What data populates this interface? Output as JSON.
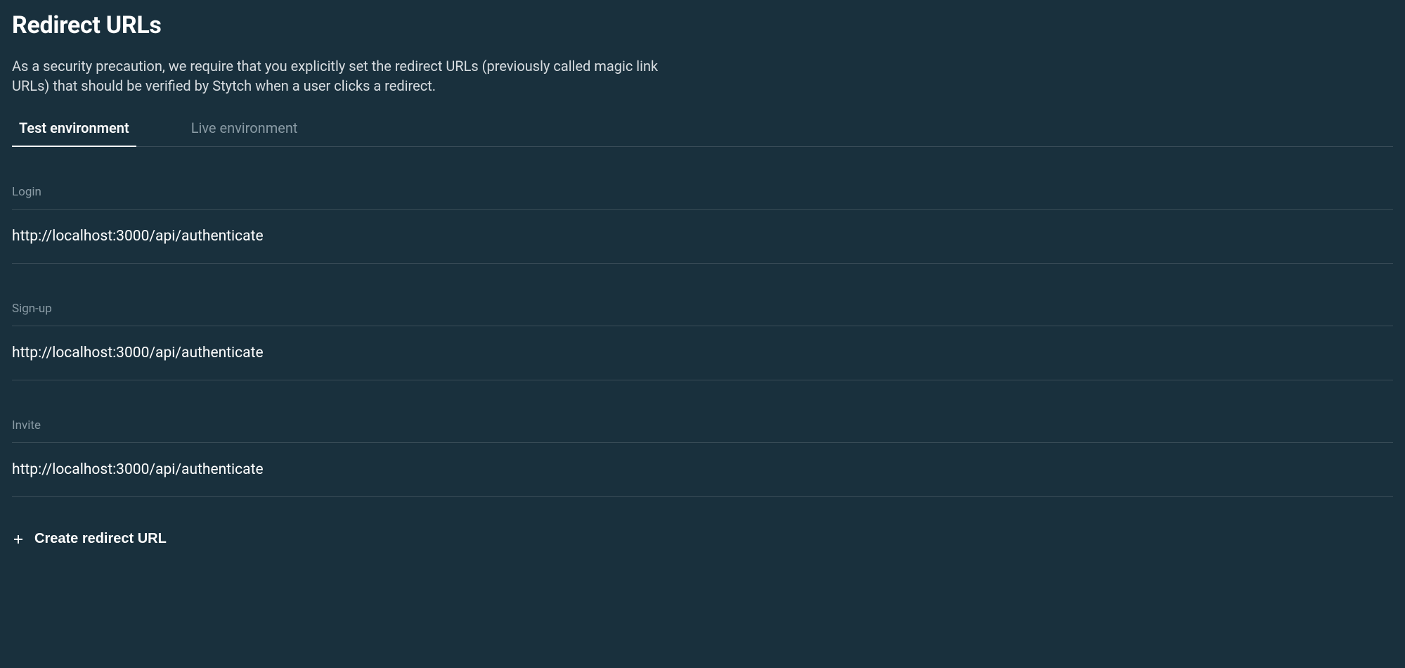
{
  "header": {
    "title": "Redirect URLs",
    "description": "As a security precaution, we require that you explicitly set the redirect URLs (previously called magic link URLs) that should be verified by Stytch when a user clicks a redirect."
  },
  "tabs": [
    {
      "label": "Test environment",
      "active": true
    },
    {
      "label": "Live environment",
      "active": false
    }
  ],
  "sections": [
    {
      "label": "Login",
      "urls": [
        "http://localhost:3000/api/authenticate"
      ]
    },
    {
      "label": "Sign-up",
      "urls": [
        "http://localhost:3000/api/authenticate"
      ]
    },
    {
      "label": "Invite",
      "urls": [
        "http://localhost:3000/api/authenticate"
      ]
    }
  ],
  "create_button": {
    "label": "Create redirect URL"
  }
}
